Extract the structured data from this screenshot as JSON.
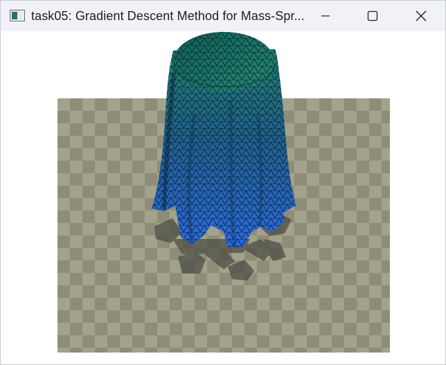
{
  "window": {
    "title": "task05: Gradient Descent Method for Mass-Spr...",
    "controls": {
      "minimize": "minimize",
      "maximize": "maximize",
      "close": "close"
    }
  },
  "viewport": {
    "scene": "cloth-draped-over-cylinder",
    "floor_colors": [
      "#8e8d77",
      "#a3a28d"
    ],
    "cloth_color_top": "#1a7c73",
    "cloth_color_bottom": "#2a66d9",
    "shadow_color": "#4e4e46"
  },
  "icons": {
    "app": "app-window-icon",
    "minimize": "minimize-icon",
    "maximize": "maximize-icon",
    "close": "close-icon"
  }
}
